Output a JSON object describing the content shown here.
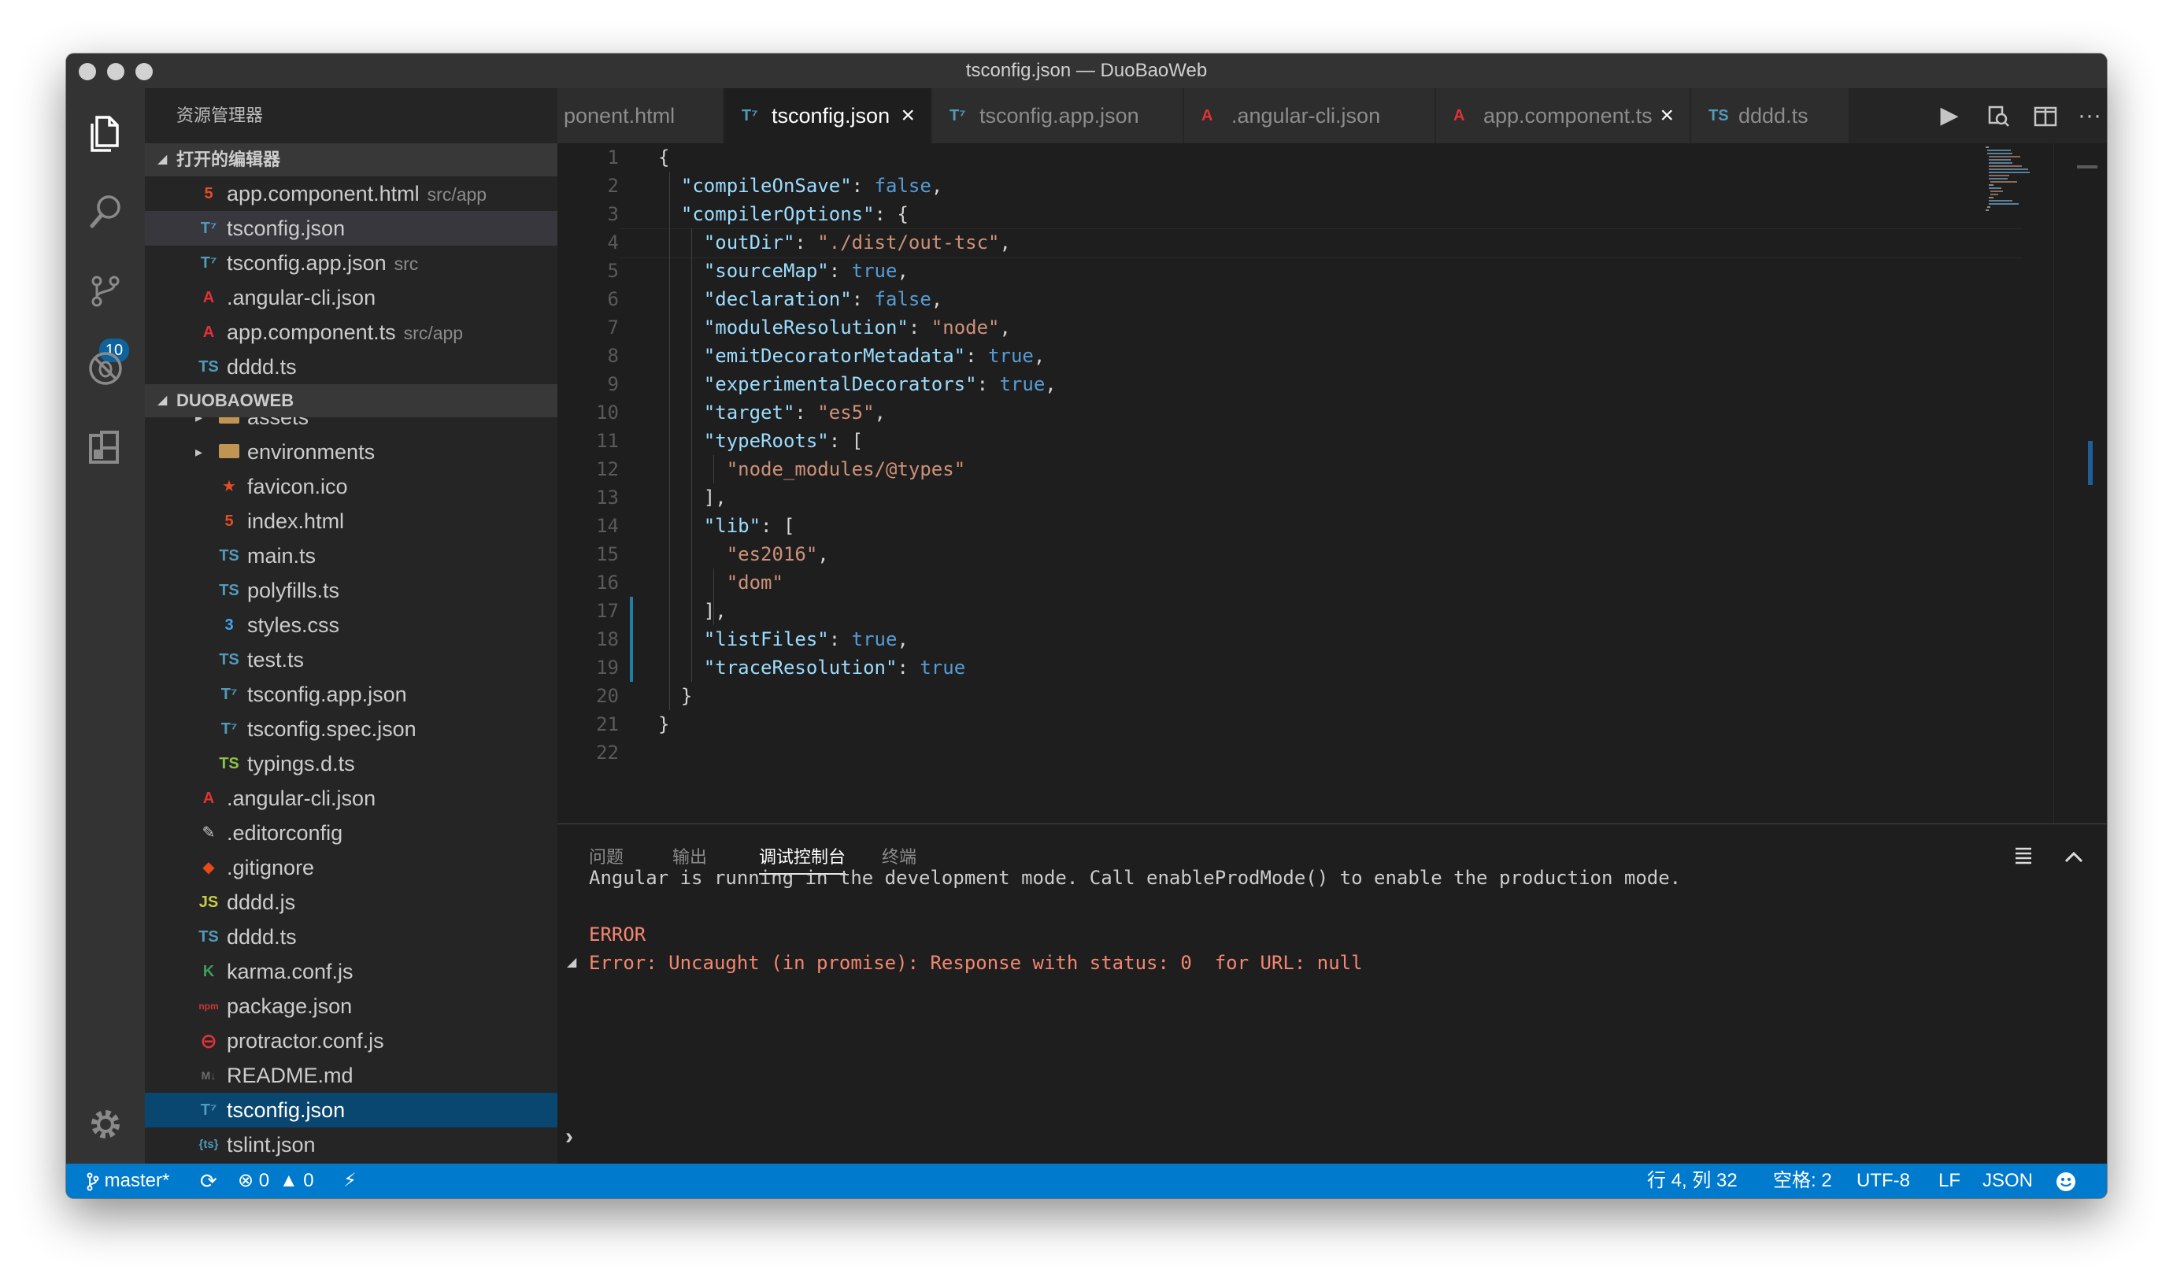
{
  "window": {
    "title": "tsconfig.json — DuoBaoWeb"
  },
  "activity": {
    "scm_badge": "10"
  },
  "sidebar": {
    "header": "资源管理器",
    "open_editors": {
      "title": "打开的编辑器",
      "items": [
        {
          "name": "app.component.html",
          "desc": "src/app",
          "icon": "5",
          "color": "#e44d26"
        },
        {
          "name": "tsconfig.json",
          "desc": "",
          "icon": "T⁷",
          "color": "#519aba"
        },
        {
          "name": "tsconfig.app.json",
          "desc": "src",
          "icon": "T⁷",
          "color": "#519aba"
        },
        {
          "name": ".angular-cli.json",
          "desc": "",
          "icon": "A",
          "color": "#e23237"
        },
        {
          "name": "app.component.ts",
          "desc": "src/app",
          "icon": "A",
          "color": "#e23237"
        },
        {
          "name": "dddd.ts",
          "desc": "",
          "icon": "TS",
          "color": "#519aba"
        }
      ]
    },
    "project": {
      "title": "DUOBAOWEB",
      "items": [
        {
          "name": "assets",
          "type": "folder"
        },
        {
          "name": "environments",
          "type": "folder"
        },
        {
          "name": "favicon.ico",
          "icon": "★",
          "color": "#e44d26"
        },
        {
          "name": "index.html",
          "icon": "5",
          "color": "#e44d26"
        },
        {
          "name": "main.ts",
          "icon": "TS",
          "color": "#519aba"
        },
        {
          "name": "polyfills.ts",
          "icon": "TS",
          "color": "#519aba"
        },
        {
          "name": "styles.css",
          "icon": "3",
          "color": "#42a5f5"
        },
        {
          "name": "test.ts",
          "icon": "TS",
          "color": "#519aba"
        },
        {
          "name": "tsconfig.app.json",
          "icon": "T⁷",
          "color": "#519aba"
        },
        {
          "name": "tsconfig.spec.json",
          "icon": "T⁷",
          "color": "#519aba"
        },
        {
          "name": "typings.d.ts",
          "icon": "TS",
          "color": "#8dc149"
        },
        {
          "name": ".angular-cli.json",
          "icon": "A",
          "color": "#e23237"
        },
        {
          "name": ".editorconfig",
          "icon": "✎",
          "color": "#cccccc"
        },
        {
          "name": ".gitignore",
          "icon": "◆",
          "color": "#e64a19"
        },
        {
          "name": "dddd.js",
          "icon": "JS",
          "color": "#cbcb41"
        },
        {
          "name": "dddd.ts",
          "icon": "TS",
          "color": "#519aba"
        },
        {
          "name": "karma.conf.js",
          "icon": "K",
          "color": "#3c9f5a"
        },
        {
          "name": "package.json",
          "icon": "npm",
          "color": "#cb3837"
        },
        {
          "name": "protractor.conf.js",
          "icon": "⊖",
          "color": "#e23237"
        },
        {
          "name": "README.md",
          "icon": "M↓",
          "color": "#6d6d6d"
        },
        {
          "name": "tsconfig.json",
          "icon": "T⁷",
          "color": "#519aba"
        },
        {
          "name": "tslint.json",
          "icon": "{ts}",
          "color": "#519aba"
        }
      ]
    }
  },
  "tabs": [
    {
      "label": "ponent.html",
      "icon": ""
    },
    {
      "label": "tsconfig.json",
      "icon": "T⁷"
    },
    {
      "label": "tsconfig.app.json",
      "icon": "T⁷"
    },
    {
      "label": ".angular-cli.json",
      "icon": "A"
    },
    {
      "label": "app.component.ts",
      "icon": "A"
    },
    {
      "label": "dddd.ts",
      "icon": "TS"
    }
  ],
  "editor": {
    "line_numbers": [
      "1",
      "2",
      "3",
      "4",
      "5",
      "6",
      "7",
      "8",
      "9",
      "10",
      "11",
      "12",
      "13",
      "14",
      "15",
      "16",
      "17",
      "18",
      "19",
      "20",
      "21",
      "22"
    ],
    "lines": [
      [
        {
          "t": "{",
          "c": "p"
        }
      ],
      [
        {
          "t": "  ",
          "c": "p"
        },
        {
          "t": "\"compileOnSave\"",
          "c": "k"
        },
        {
          "t": ": ",
          "c": "p"
        },
        {
          "t": "false",
          "c": "b"
        },
        {
          "t": ",",
          "c": "p"
        }
      ],
      [
        {
          "t": "  ",
          "c": "p"
        },
        {
          "t": "\"compilerOptions\"",
          "c": "k"
        },
        {
          "t": ": {",
          "c": "p"
        }
      ],
      [
        {
          "t": "    ",
          "c": "p"
        },
        {
          "t": "\"outDir\"",
          "c": "k"
        },
        {
          "t": ": ",
          "c": "p"
        },
        {
          "t": "\"./dist/out-tsc\"",
          "c": "s"
        },
        {
          "t": ",",
          "c": "p"
        }
      ],
      [
        {
          "t": "    ",
          "c": "p"
        },
        {
          "t": "\"sourceMap\"",
          "c": "k"
        },
        {
          "t": ": ",
          "c": "p"
        },
        {
          "t": "true",
          "c": "b"
        },
        {
          "t": ",",
          "c": "p"
        }
      ],
      [
        {
          "t": "    ",
          "c": "p"
        },
        {
          "t": "\"declaration\"",
          "c": "k"
        },
        {
          "t": ": ",
          "c": "p"
        },
        {
          "t": "false",
          "c": "b"
        },
        {
          "t": ",",
          "c": "p"
        }
      ],
      [
        {
          "t": "    ",
          "c": "p"
        },
        {
          "t": "\"moduleResolution\"",
          "c": "k"
        },
        {
          "t": ": ",
          "c": "p"
        },
        {
          "t": "\"node\"",
          "c": "s"
        },
        {
          "t": ",",
          "c": "p"
        }
      ],
      [
        {
          "t": "    ",
          "c": "p"
        },
        {
          "t": "\"emitDecoratorMetadata\"",
          "c": "k"
        },
        {
          "t": ": ",
          "c": "p"
        },
        {
          "t": "true",
          "c": "b"
        },
        {
          "t": ",",
          "c": "p"
        }
      ],
      [
        {
          "t": "    ",
          "c": "p"
        },
        {
          "t": "\"experimentalDecorators\"",
          "c": "k"
        },
        {
          "t": ": ",
          "c": "p"
        },
        {
          "t": "true",
          "c": "b"
        },
        {
          "t": ",",
          "c": "p"
        }
      ],
      [
        {
          "t": "    ",
          "c": "p"
        },
        {
          "t": "\"target\"",
          "c": "k"
        },
        {
          "t": ": ",
          "c": "p"
        },
        {
          "t": "\"es5\"",
          "c": "s"
        },
        {
          "t": ",",
          "c": "p"
        }
      ],
      [
        {
          "t": "    ",
          "c": "p"
        },
        {
          "t": "\"typeRoots\"",
          "c": "k"
        },
        {
          "t": ": [",
          "c": "p"
        }
      ],
      [
        {
          "t": "      ",
          "c": "p"
        },
        {
          "t": "\"node_modules/@types\"",
          "c": "s"
        }
      ],
      [
        {
          "t": "    ],",
          "c": "p"
        }
      ],
      [
        {
          "t": "    ",
          "c": "p"
        },
        {
          "t": "\"lib\"",
          "c": "k"
        },
        {
          "t": ": [",
          "c": "p"
        }
      ],
      [
        {
          "t": "      ",
          "c": "p"
        },
        {
          "t": "\"es2016\"",
          "c": "s"
        },
        {
          "t": ",",
          "c": "p"
        }
      ],
      [
        {
          "t": "      ",
          "c": "p"
        },
        {
          "t": "\"dom\"",
          "c": "s"
        }
      ],
      [
        {
          "t": "    ],",
          "c": "p"
        }
      ],
      [
        {
          "t": "    ",
          "c": "p"
        },
        {
          "t": "\"listFiles\"",
          "c": "k"
        },
        {
          "t": ": ",
          "c": "p"
        },
        {
          "t": "true",
          "c": "b"
        },
        {
          "t": ",",
          "c": "p"
        }
      ],
      [
        {
          "t": "    ",
          "c": "p"
        },
        {
          "t": "\"traceResolution\"",
          "c": "k"
        },
        {
          "t": ": ",
          "c": "p"
        },
        {
          "t": "true",
          "c": "b"
        }
      ],
      [
        {
          "t": "  }",
          "c": "p"
        }
      ],
      [
        {
          "t": "}",
          "c": "p"
        }
      ],
      []
    ]
  },
  "panel": {
    "tabs": [
      "问题",
      "输出",
      "调试控制台",
      "终端"
    ],
    "active_tab": "调试控制台",
    "output": {
      "line1": "Angular is running in the development mode. Call enableProdMode() to enable the production mode.",
      "line2": "ERROR",
      "line3": "Error: Uncaught (in promise): Response with status: 0  for URL: null"
    },
    "prompt": "›"
  },
  "statusbar": {
    "branch": "master*",
    "errors": "0",
    "warnings": "0",
    "position": "行 4, 列 32",
    "indent": "空格: 2",
    "encoding": "UTF-8",
    "eol": "LF",
    "language": "JSON",
    "accent": "#007acc"
  }
}
